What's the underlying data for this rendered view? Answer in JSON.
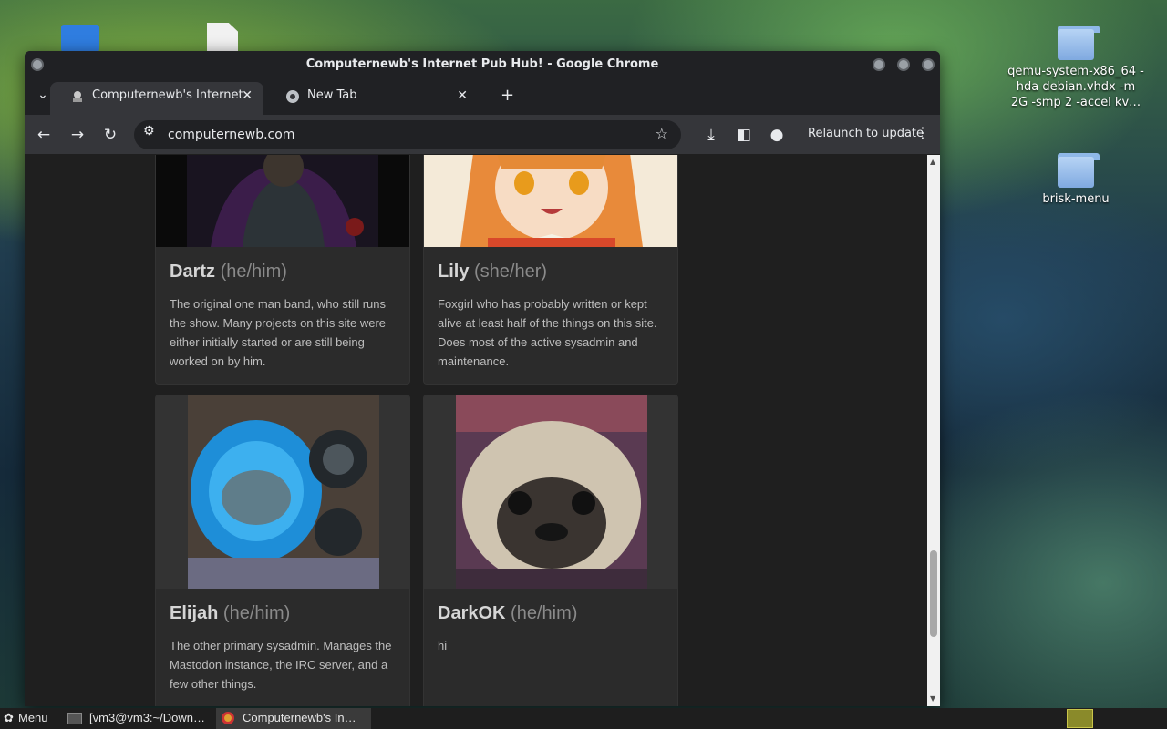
{
  "desktop": {
    "icons": [
      {
        "label": "qemu-system-x86_64 -hda debian.vhdx -m 2G -smp 2 -accel kv…"
      },
      {
        "label": "brisk-menu"
      }
    ]
  },
  "window": {
    "title": "Computernewb's Internet Pub Hub! - Google Chrome"
  },
  "tabs": [
    {
      "label": "Computernewb's Internet Pub Hub!",
      "close": "✕"
    },
    {
      "label": "New Tab",
      "close": "✕"
    }
  ],
  "toolbar": {
    "url": "computernewb.com",
    "relaunch_label": "Relaunch to update"
  },
  "cards": [
    {
      "name": "Dartz",
      "pronouns": "(he/him)",
      "description": "The original one man band, who still runs the show. Many projects on this site were either initially started or are still being worked on by him."
    },
    {
      "name": "Lily",
      "pronouns": "(she/her)",
      "description": "Foxgirl who has probably written or kept alive at least half of the things on this site. Does most of the active sysadmin and maintenance."
    },
    {
      "name": "Elijah",
      "pronouns": "(he/him)",
      "description": "The other primary sysadmin. Manages the Mastodon instance, the IRC server, and a few other things."
    },
    {
      "name": "DarkOK",
      "pronouns": "(he/him)",
      "description": "hi"
    }
  ],
  "taskbar": {
    "menu_label": "Menu",
    "items": [
      {
        "label": "[vm3@vm3:~/Down…"
      },
      {
        "label": "Computernewb's In…"
      }
    ]
  },
  "colors": {
    "chrome_dark": "#202124",
    "toolbar": "#35363a",
    "page_bg": "#1f1f1f",
    "card_bg": "#2b2b2b"
  }
}
